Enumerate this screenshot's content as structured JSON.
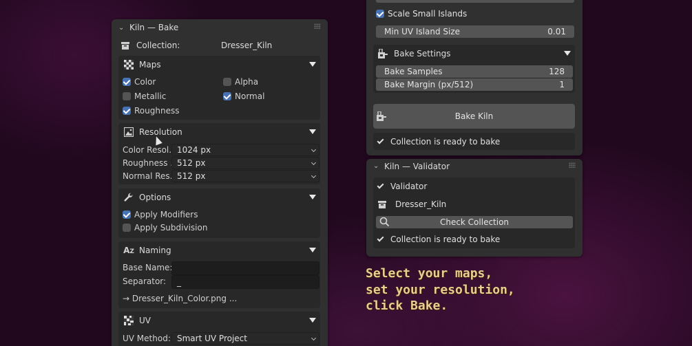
{
  "bake_panel": {
    "title": "Kiln — Bake",
    "collection_label": "Collection:",
    "collection_value": "Dresser_Kiln",
    "maps": {
      "title": "Maps",
      "color": {
        "label": "Color",
        "checked": true
      },
      "alpha": {
        "label": "Alpha",
        "checked": false
      },
      "metallic": {
        "label": "Metallic",
        "checked": false
      },
      "normal": {
        "label": "Normal",
        "checked": true
      },
      "roughness": {
        "label": "Roughness",
        "checked": true
      }
    },
    "resolution": {
      "title": "Resolution",
      "color_label": "Color Resol...",
      "color_value": "1024 px",
      "roughness_label": "Roughness ...",
      "roughness_value": "512 px",
      "normal_label": "Normal Res...",
      "normal_value": "512 px"
    },
    "options": {
      "title": "Options",
      "apply_modifiers": {
        "label": "Apply Modifiers",
        "checked": true
      },
      "apply_subdivision": {
        "label": "Apply Subdivision",
        "checked": false
      }
    },
    "naming": {
      "title": "Naming",
      "base_name_label": "Base Name:",
      "base_name_value": "",
      "separator_label": "Separator:",
      "separator_value": "_",
      "preview": "→ Dresser_Kiln_Color.png ..."
    },
    "uv": {
      "title": "UV",
      "method_label": "UV Method:",
      "method_value": "Smart UV Project"
    }
  },
  "right_panel": {
    "scale_small_islands": {
      "label": "Scale Small Islands",
      "checked": true
    },
    "min_uv_island_size": {
      "label": "Min UV Island Size",
      "value": "0.01"
    },
    "bake_settings": {
      "title": "Bake Settings",
      "samples_label": "Bake Samples",
      "samples_value": "128",
      "margin_label": "Bake Margin (px/512)",
      "margin_value": "1"
    },
    "bake_button": "Bake Kiln",
    "status": "Collection is ready to bake"
  },
  "validator_panel": {
    "title": "Kiln — Validator",
    "validator_label": "Validator",
    "collection_name": "Dresser_Kiln",
    "check_button": "Check Collection",
    "status": "Collection is ready to bake"
  },
  "annotation": {
    "line1": "Select your maps,",
    "line2": "set your resolution,",
    "line3": "click Bake."
  },
  "colors": {
    "accent": "#4772b3",
    "panel": "#303030",
    "annotation": "#e6cf95"
  }
}
